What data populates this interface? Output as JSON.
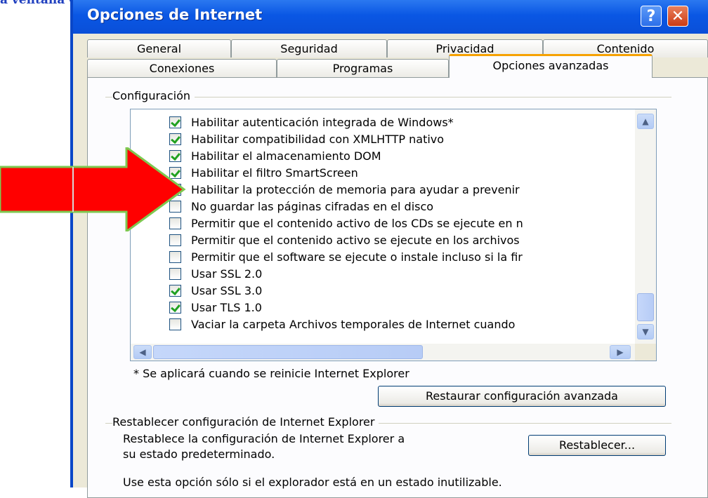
{
  "caption": "a ventana Opciones de Internet → Opciones avanzadas",
  "window": {
    "title": "Opciones de Internet",
    "help_label": "?",
    "close_label": "✕"
  },
  "tabs_row1": [
    "General",
    "Seguridad",
    "Privacidad",
    "Contenido"
  ],
  "tabs_row2": [
    "Conexiones",
    "Programas",
    "Opciones avanzadas"
  ],
  "settings": {
    "group_label": "Configuración",
    "items": [
      {
        "label": "Habilitar autenticación integrada de Windows*",
        "checked": true
      },
      {
        "label": "Habilitar compatibilidad con XMLHTTP nativo",
        "checked": true
      },
      {
        "label": "Habilitar el almacenamiento DOM",
        "checked": true
      },
      {
        "label": "Habilitar el filtro SmartScreen",
        "checked": true
      },
      {
        "label": "Habilitar la protección de memoria para ayudar a prevenir",
        "checked": false
      },
      {
        "label": "No guardar las páginas cifradas en el disco",
        "checked": false
      },
      {
        "label": "Permitir que el contenido activo de los CDs se ejecute en n",
        "checked": false
      },
      {
        "label": "Permitir que el contenido activo se ejecute en los archivos",
        "checked": false
      },
      {
        "label": "Permitir que el software se ejecute o instale incluso si la fir",
        "checked": false
      },
      {
        "label": "Usar SSL 2.0",
        "checked": false
      },
      {
        "label": "Usar SSL 3.0",
        "checked": true
      },
      {
        "label": "Usar TLS 1.0",
        "checked": true
      },
      {
        "label": "Vaciar la carpeta Archivos temporales de Internet cuando",
        "checked": false
      }
    ],
    "note": "* Se aplicará cuando se reinicie Internet Explorer",
    "restore_button": "Restaurar configuración avanzada"
  },
  "reset": {
    "group_label": "Restablecer configuración de Internet Explorer",
    "description_line1": "Restablece la configuración de Internet Explorer a",
    "description_line2": "su estado predeterminado.",
    "button": "Restablecer...",
    "warning": "Use esta opción sólo si el explorador está en un estado inutilizable."
  },
  "colors": {
    "title_bar": "#0a57e4",
    "dialog_face": "#ece9d8",
    "checkmark": "#21a121",
    "arrow": "#ff0000",
    "arrow_border": "#7ec850"
  }
}
